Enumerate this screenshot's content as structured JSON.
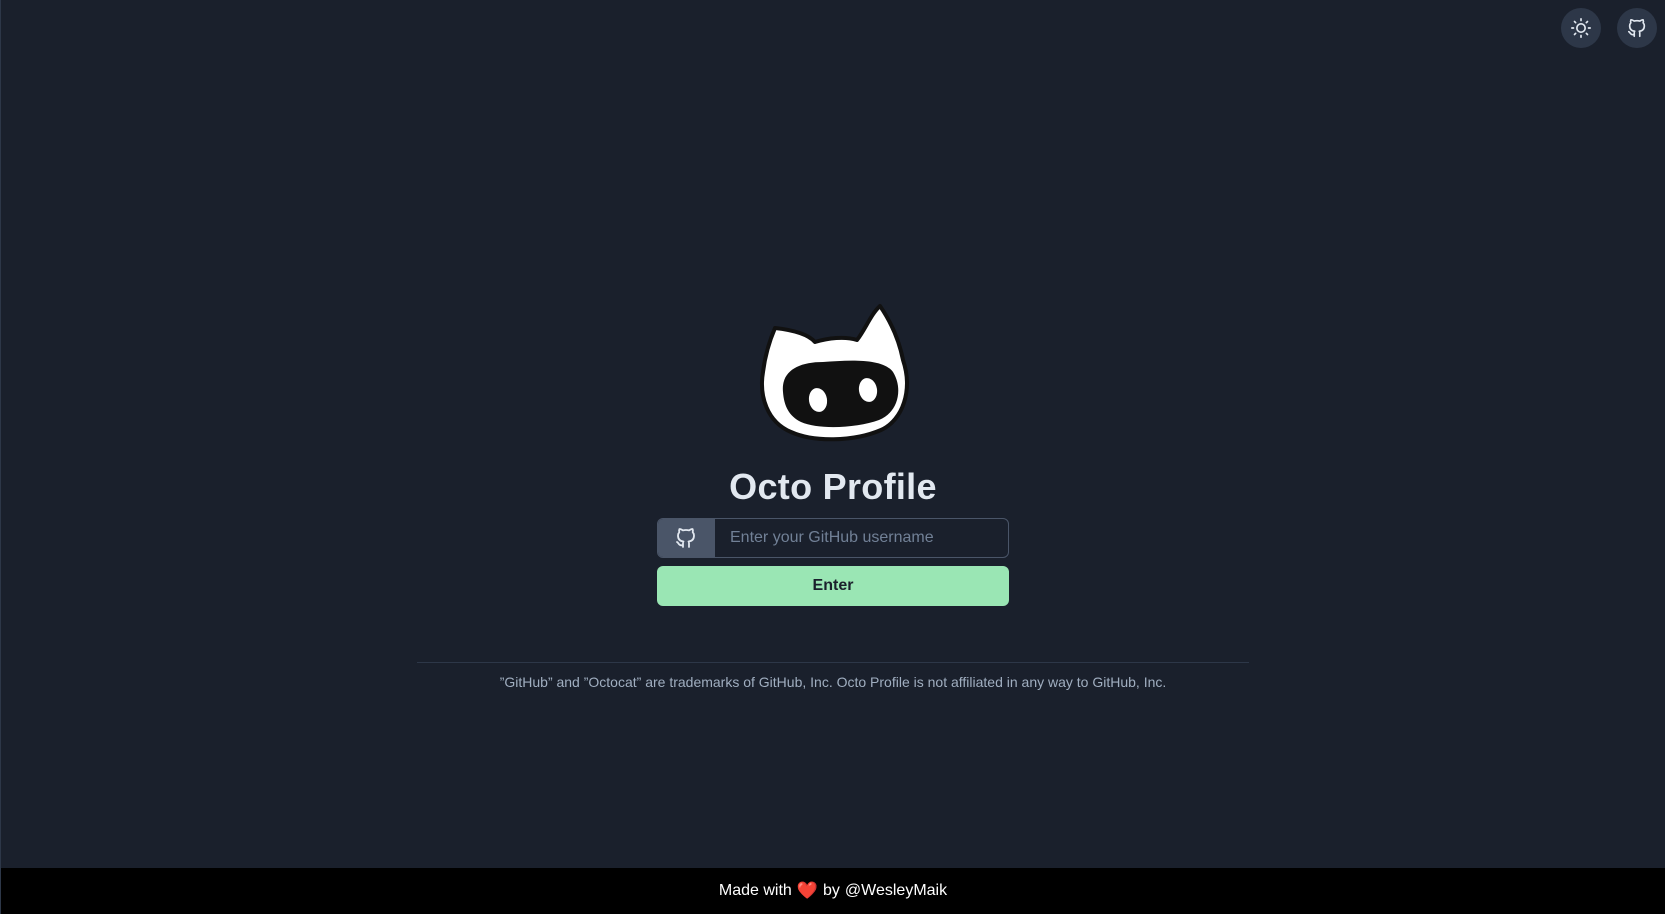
{
  "header": {
    "theme_toggle_icon": "sun-icon",
    "github_link_icon": "github-icon"
  },
  "main": {
    "title": "Octo Profile",
    "input_addon_icon": "github-icon",
    "username_placeholder": "Enter your GitHub username",
    "username_value": "",
    "enter_label": "Enter",
    "disclaimer": "”GitHub” and ”Octocat” are trademarks of GitHub, Inc. Octo Profile is not affiliated in any way to GitHub, Inc."
  },
  "footer": {
    "made_with": "Made with",
    "heart_icon": "heart-icon",
    "heart": "❤️",
    "by": "by",
    "author": "@WesleyMaik"
  },
  "colors": {
    "background": "#1a202c",
    "accent_button": "#9ae6b4",
    "footer_bg": "#000000",
    "heart": "#e53e3e"
  }
}
